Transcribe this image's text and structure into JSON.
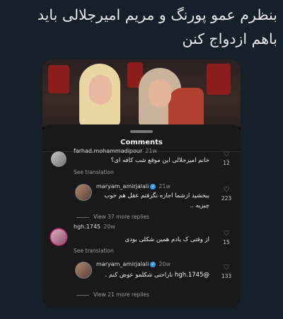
{
  "post": {
    "headline": "بنظرم عمو پورنگ و مریم امیرجلالی باید باهم ازدواج کنن"
  },
  "sheet": {
    "title": "Comments"
  },
  "comments": [
    {
      "username": "farhad.mohammadipour",
      "time": "21w",
      "text": "خانم امیرجلالی این موقع شب کافه ای؟",
      "likes": "12",
      "translate": "See translation"
    },
    {
      "username": "maryam_amirjalali",
      "verified": true,
      "time": "21w",
      "text": "ببخشید ازشما اجازه نگرفتم عقل هم خوب چیزیه ..",
      "likes": "223",
      "more": "View 37 more replies"
    },
    {
      "username": "hgh.1745",
      "time": "20w",
      "text": "از وقتی ک یادم همین شکلی بودی",
      "likes": "15",
      "translate": "See translation"
    },
    {
      "username": "maryam_amirjalali",
      "verified": true,
      "time": "20w",
      "text": "@hgh.1745 ناراحتی شکلمو عوض کنم .",
      "likes": "133",
      "more": "View 21 more replies"
    }
  ],
  "icons": {
    "like": "heart-outline-icon",
    "verified": "verified-badge-icon"
  },
  "colors": {
    "background": "#16202b",
    "sheet": "#191919",
    "verified": "#3797f0"
  }
}
